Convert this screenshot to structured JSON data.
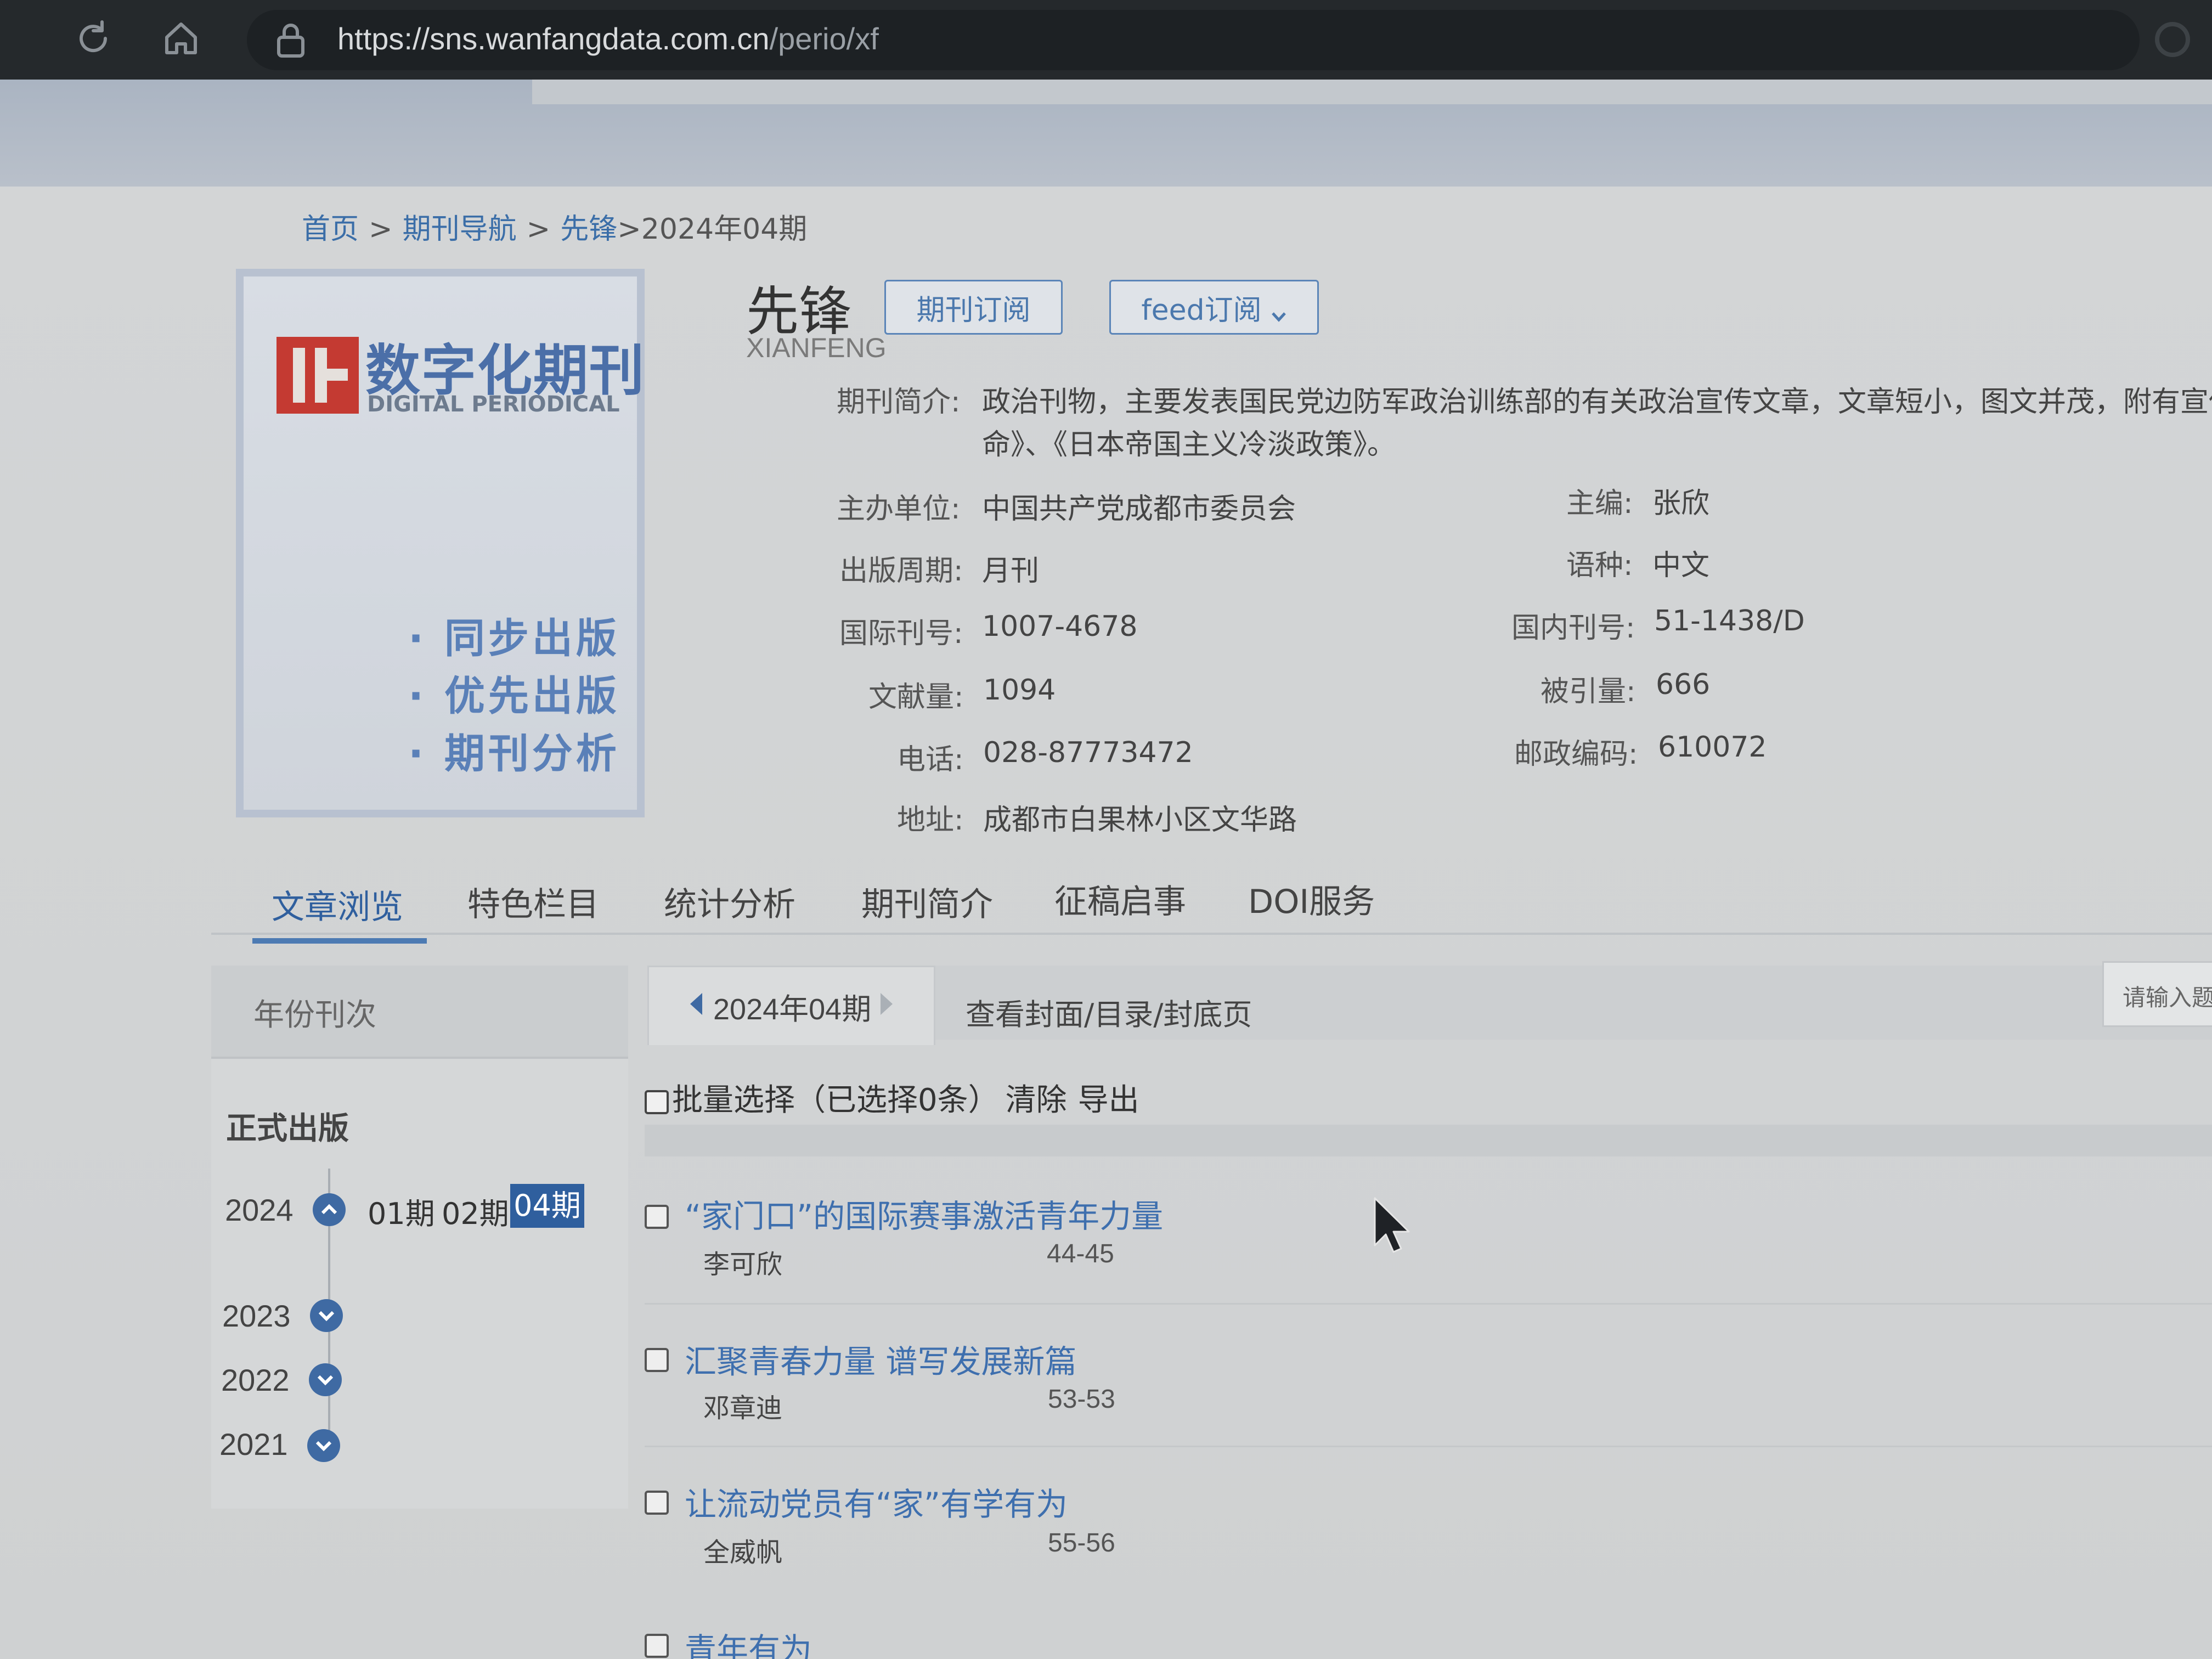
{
  "browser": {
    "url_host": "https://sns.wanfangdata.com.cn",
    "url_path": "/perio/xf",
    "icons": [
      "reload-icon",
      "home-icon",
      "lock-icon",
      "extension-icon"
    ]
  },
  "breadcrumb": {
    "home": "首页",
    "nav": "期刊导航",
    "journal": "先锋",
    "current": ">2024年04期",
    "separator": ">"
  },
  "cover": {
    "logo_cn": "数字化期刊",
    "logo_en": "DIGITAL PERIODICAL",
    "features": [
      "· 同步出版",
      "· 优先出版",
      "· 期刊分析"
    ]
  },
  "journal": {
    "title": "先锋",
    "pinyin": "XIANFENG",
    "subscribe_button": "期刊订阅",
    "feed_button": "feed订阅",
    "intro_label": "期刊简介:",
    "intro_line1": "政治刊物，主要发表国民党边防军政治训练部的有关政治宣传文章，文章短小，图文并茂，附有宣传",
    "intro_line2": "命》、《日本帝国主义冷淡政策》。",
    "sponsor_label": "主办单位:",
    "sponsor": "中国共产党成都市委员会",
    "editor_label": "主编:",
    "editor": "张欣",
    "frequency_label": "出版周期:",
    "frequency": "月刊",
    "language_label": "语种:",
    "language": "中文",
    "issn_label": "国际刊号:",
    "issn": "1007-4678",
    "cn_label": "国内刊号:",
    "cn": "51-1438/D",
    "docs_label": "文献量:",
    "docs": "1094",
    "cited_label": "被引量:",
    "cited": "666",
    "phone_label": "电话:",
    "phone": "028-87773472",
    "postcode_label": "邮政编码:",
    "postcode": "610072",
    "address_label": "地址:",
    "address": "成都市白果林小区文华路"
  },
  "tabs": [
    "文章浏览",
    "特色栏目",
    "统计分析",
    "期刊简介",
    "征稿启事",
    "DOI服务"
  ],
  "sidebar": {
    "title": "年份刊次",
    "formal_label": "正式出版",
    "years": [
      "2024",
      "2023",
      "2022",
      "2021"
    ],
    "issues_2024": [
      "01期",
      "02期",
      "04期"
    ],
    "selected_issue": "04期"
  },
  "list": {
    "issue_tab": "2024年04期",
    "cover_toc": "查看封面/目录/封底页",
    "search_placeholder": "请输入题",
    "batch_text": "批量选择（已选择0条）",
    "clear_label": "清除",
    "export_label": "导出",
    "articles": [
      {
        "title": "“家门口”的国际赛事激活青年力量",
        "author": "李可欣",
        "pages": "44-45"
      },
      {
        "title": "汇聚青春力量 谱写发展新篇",
        "author": "邓章迪",
        "pages": "53-53"
      },
      {
        "title": "让流动党员有“家”有学有为",
        "author": "全威帆",
        "pages": "55-56"
      },
      {
        "title": "青年有为",
        "author": "",
        "pages": ""
      }
    ]
  },
  "colors": {
    "accent": "#3f6aa3",
    "link": "#3e6fae",
    "selected_issue_bg": "#2f5f9e",
    "cover_red": "#c43a32"
  }
}
